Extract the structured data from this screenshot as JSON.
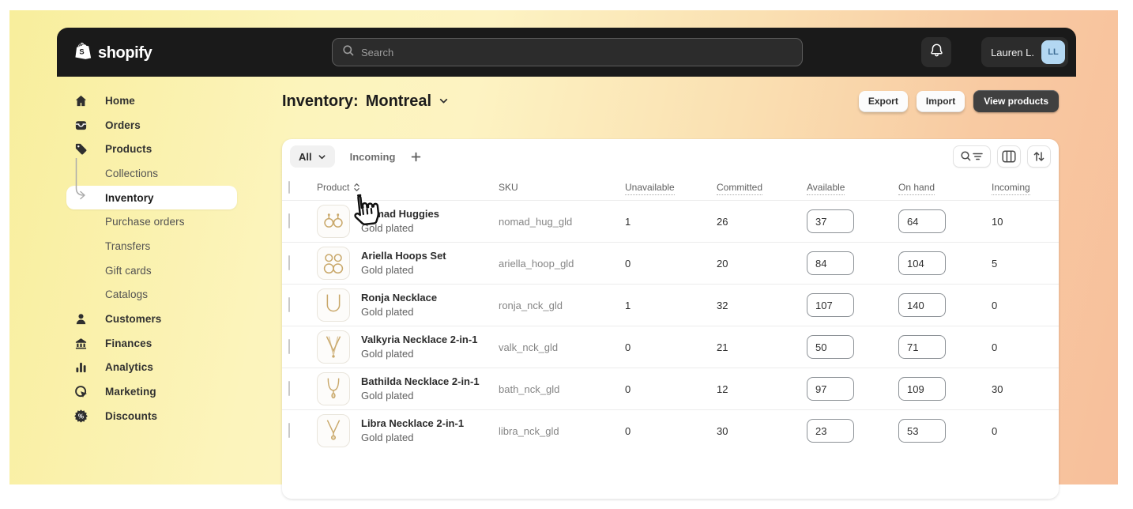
{
  "topbar": {
    "logo_text": "shopify",
    "search_placeholder": "Search",
    "user": {
      "name": "Lauren L.",
      "initials": "LL"
    }
  },
  "sidebar": {
    "items": [
      {
        "label": "Home",
        "icon": "home-icon"
      },
      {
        "label": "Orders",
        "icon": "orders-icon"
      },
      {
        "label": "Products",
        "icon": "products-icon"
      },
      {
        "label": "Collections",
        "sub": true
      },
      {
        "label": "Inventory",
        "sub": true,
        "selected": true
      },
      {
        "label": "Purchase orders",
        "sub": true
      },
      {
        "label": "Transfers",
        "sub": true
      },
      {
        "label": "Gift cards",
        "sub": true
      },
      {
        "label": "Catalogs",
        "sub": true
      },
      {
        "label": "Customers",
        "icon": "customers-icon"
      },
      {
        "label": "Finances",
        "icon": "finances-icon"
      },
      {
        "label": "Analytics",
        "icon": "analytics-icon"
      },
      {
        "label": "Marketing",
        "icon": "marketing-icon"
      },
      {
        "label": "Discounts",
        "icon": "discounts-icon"
      }
    ]
  },
  "page": {
    "title_prefix": "Inventory:",
    "location": "Montreal",
    "actions": {
      "export": "Export",
      "import": "Import",
      "view_products": "View products"
    }
  },
  "inventory_table": {
    "filter_all_label": "All",
    "tab_incoming_label": "Incoming",
    "columns": [
      "Product",
      "SKU",
      "Unavailable",
      "Committed",
      "Available",
      "On hand",
      "Incoming"
    ],
    "rows": [
      {
        "name": "Nomad Huggies",
        "variant": "Gold plated",
        "sku": "nomad_hug_gld",
        "unavailable": "1",
        "committed": "26",
        "available": "37",
        "on_hand": "64",
        "incoming": "10",
        "thumb": "huggies-thumb"
      },
      {
        "name": "Ariella Hoops Set",
        "variant": "Gold plated",
        "sku": "ariella_hoop_gld",
        "unavailable": "0",
        "committed": "20",
        "available": "84",
        "on_hand": "104",
        "incoming": "5",
        "thumb": "hoops-thumb"
      },
      {
        "name": "Ronja Necklace",
        "variant": "Gold plated",
        "sku": "ronja_nck_gld",
        "unavailable": "1",
        "committed": "32",
        "available": "107",
        "on_hand": "140",
        "incoming": "0",
        "thumb": "necklace-u-thumb"
      },
      {
        "name": "Valkyria Necklace 2-in-1",
        "variant": "Gold plated",
        "sku": "valk_nck_gld",
        "unavailable": "0",
        "committed": "21",
        "available": "50",
        "on_hand": "71",
        "incoming": "0",
        "thumb": "necklace-v-thumb"
      },
      {
        "name": "Bathilda Necklace 2-in-1",
        "variant": "Gold plated",
        "sku": "bath_nck_gld",
        "unavailable": "0",
        "committed": "12",
        "available": "97",
        "on_hand": "109",
        "incoming": "30",
        "thumb": "necklace-drop-thumb"
      },
      {
        "name": "Libra Necklace 2-in-1",
        "variant": "Gold plated",
        "sku": "libra_nck_gld",
        "unavailable": "0",
        "committed": "30",
        "available": "23",
        "on_hand": "53",
        "incoming": "0",
        "thumb": "necklace-pendant-thumb"
      }
    ]
  },
  "colors": {
    "topbar_bg": "#1a1a1a",
    "avatar_bg": "#b3d7f2",
    "avatar_text": "#3f6e96",
    "gradient_left": "#f8ee9c",
    "gradient_right": "#f7bf9b",
    "gold_accent": "#c8a468",
    "selected_item_bg": "#ffffff"
  }
}
